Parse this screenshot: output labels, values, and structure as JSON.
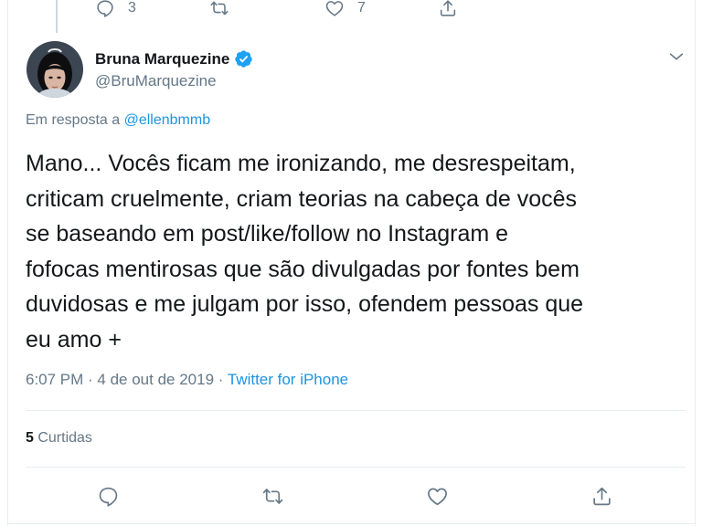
{
  "previous_tweet": {
    "reply_count": "3",
    "like_count": "7"
  },
  "tweet": {
    "author_name": "Bruna Marquezine",
    "author_handle": "@BruMarquezine",
    "reply_prefix": "Em resposta a ",
    "reply_to_handle": "@ellenbmmb",
    "text_lines": [
      "Mano... Vocês ficam me ironizando, me desrespeitam,",
      "criticam cruelmente, criam teorias na cabeça de vocês",
      "se baseando em post/like/follow no Instagram e",
      "fofocas mentirosas que são divulgadas por fontes bem",
      "duvidosas e me julgam por isso, ofendem pessoas que",
      "eu amo +"
    ],
    "timestamp": "6:07 PM · 4 de out de 2019 · ",
    "source": "Twitter for iPhone",
    "likes_count": "5",
    "likes_label": " Curtidas"
  },
  "icons": {
    "verified_color": "#1da1f2",
    "link_color": "#1b95e0",
    "muted_color": "#657786"
  }
}
